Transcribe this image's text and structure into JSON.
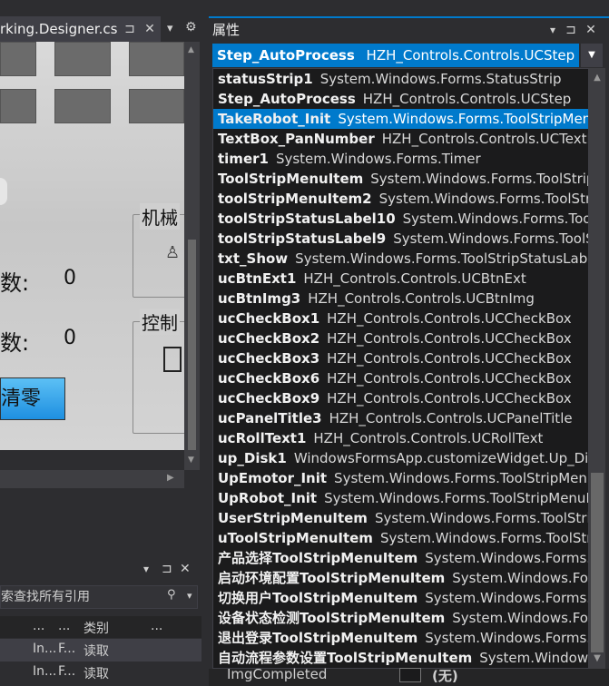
{
  "document": {
    "tab_title": "rking.Designer.cs",
    "pin_glyph": "⊐",
    "close_glyph": "✕",
    "dropdown_glyph": "▾",
    "settings_glyph": "⚙"
  },
  "designer": {
    "group1_title": "机械",
    "group2_title": "控制",
    "count_label_1": "数:",
    "count_value_1": "0",
    "count_label_2": "数:",
    "count_value_2": "0",
    "clear_button": "清零"
  },
  "tool_window": {
    "search_text": "索查找所有引用",
    "search_icon": "🔍",
    "header_col1": "...",
    "header_col2": "...",
    "header_col3": "类别",
    "header_col4": "...",
    "rows": [
      {
        "c1": "In...",
        "c2": "F...",
        "c3": "读取"
      },
      {
        "c1": "In...",
        "c2": "F...",
        "c3": "读取"
      }
    ],
    "dropdown_glyph": "▾",
    "pin_glyph": "⊐",
    "close_glyph": "✕"
  },
  "properties": {
    "title": "属性",
    "selected_object": {
      "name": "Step_AutoProcess",
      "type": "HZH_Controls.Controls.UCStep"
    },
    "dropdown_items": [
      {
        "name": "statusStrip1",
        "type": "System.Windows.Forms.StatusStrip"
      },
      {
        "name": "Step_AutoProcess",
        "type": "HZH_Controls.Controls.UCStep"
      },
      {
        "name": "TakeRobot_Init",
        "type": "System.Windows.Forms.ToolStripMenuItem",
        "selected": true
      },
      {
        "name": "TextBox_PanNumber",
        "type": "HZH_Controls.Controls.UCTextBox"
      },
      {
        "name": "timer1",
        "type": "System.Windows.Forms.Timer"
      },
      {
        "name": "ToolStripMenuItem",
        "type": "System.Windows.Forms.ToolStripMenuItem"
      },
      {
        "name": "toolStripMenuItem2",
        "type": "System.Windows.Forms.ToolStripMenuItem"
      },
      {
        "name": "toolStripStatusLabel10",
        "type": "System.Windows.Forms.ToolStripStatusLabel"
      },
      {
        "name": "toolStripStatusLabel9",
        "type": "System.Windows.Forms.ToolStripStatusLabel"
      },
      {
        "name": "txt_Show",
        "type": "System.Windows.Forms.ToolStripStatusLabel"
      },
      {
        "name": "ucBtnExt1",
        "type": "HZH_Controls.Controls.UCBtnExt"
      },
      {
        "name": "ucBtnImg3",
        "type": "HZH_Controls.Controls.UCBtnImg"
      },
      {
        "name": "ucCheckBox1",
        "type": "HZH_Controls.Controls.UCCheckBox"
      },
      {
        "name": "ucCheckBox2",
        "type": "HZH_Controls.Controls.UCCheckBox"
      },
      {
        "name": "ucCheckBox3",
        "type": "HZH_Controls.Controls.UCCheckBox"
      },
      {
        "name": "ucCheckBox6",
        "type": "HZH_Controls.Controls.UCCheckBox"
      },
      {
        "name": "ucCheckBox9",
        "type": "HZH_Controls.Controls.UCCheckBox"
      },
      {
        "name": "ucPanelTitle3",
        "type": "HZH_Controls.Controls.UCPanelTitle"
      },
      {
        "name": "ucRollText1",
        "type": "HZH_Controls.Controls.UCRollText"
      },
      {
        "name": "up_Disk1",
        "type": "WindowsFormsApp.customizeWidget.Up_Disk"
      },
      {
        "name": "UpEmotor_Init",
        "type": "System.Windows.Forms.ToolStripMenuItem"
      },
      {
        "name": "UpRobot_Init",
        "type": "System.Windows.Forms.ToolStripMenuItem"
      },
      {
        "name": "UserStripMenuItem",
        "type": "System.Windows.Forms.ToolStripMenuItem"
      },
      {
        "name": "uToolStripMenuItem",
        "type": "System.Windows.Forms.ToolStripMenuItem"
      },
      {
        "name": "产品选择ToolStripMenuItem",
        "type": "System.Windows.Forms.ToolStripMenuItem"
      },
      {
        "name": "启动环境配置ToolStripMenuItem",
        "type": "System.Windows.Forms.ToolStripMenuItem"
      },
      {
        "name": "切换用户ToolStripMenuItem",
        "type": "System.Windows.Forms.ToolStripMenuItem"
      },
      {
        "name": "设备状态检测ToolStripMenuItem",
        "type": "System.Windows.Forms.ToolStripMenuItem"
      },
      {
        "name": "退出登录ToolStripMenuItem",
        "type": "System.Windows.Forms.ToolStripMenuItem"
      },
      {
        "name": "自动流程参数设置ToolStripMenuItem",
        "type": "System.Windows.Forms.ToolStripMenuItem"
      }
    ],
    "bottom_property": {
      "name": "ImgCompleted",
      "value": "(无)"
    },
    "dropdown_glyph": "▾",
    "pin_glyph": "⊐",
    "close_glyph": "✕",
    "scroll_up_glyph": "▲",
    "scroll_down_glyph": "▼"
  },
  "colors": {
    "accent": "#007acc",
    "selection": "#007acc",
    "clear_button": "#3aa8ee"
  }
}
